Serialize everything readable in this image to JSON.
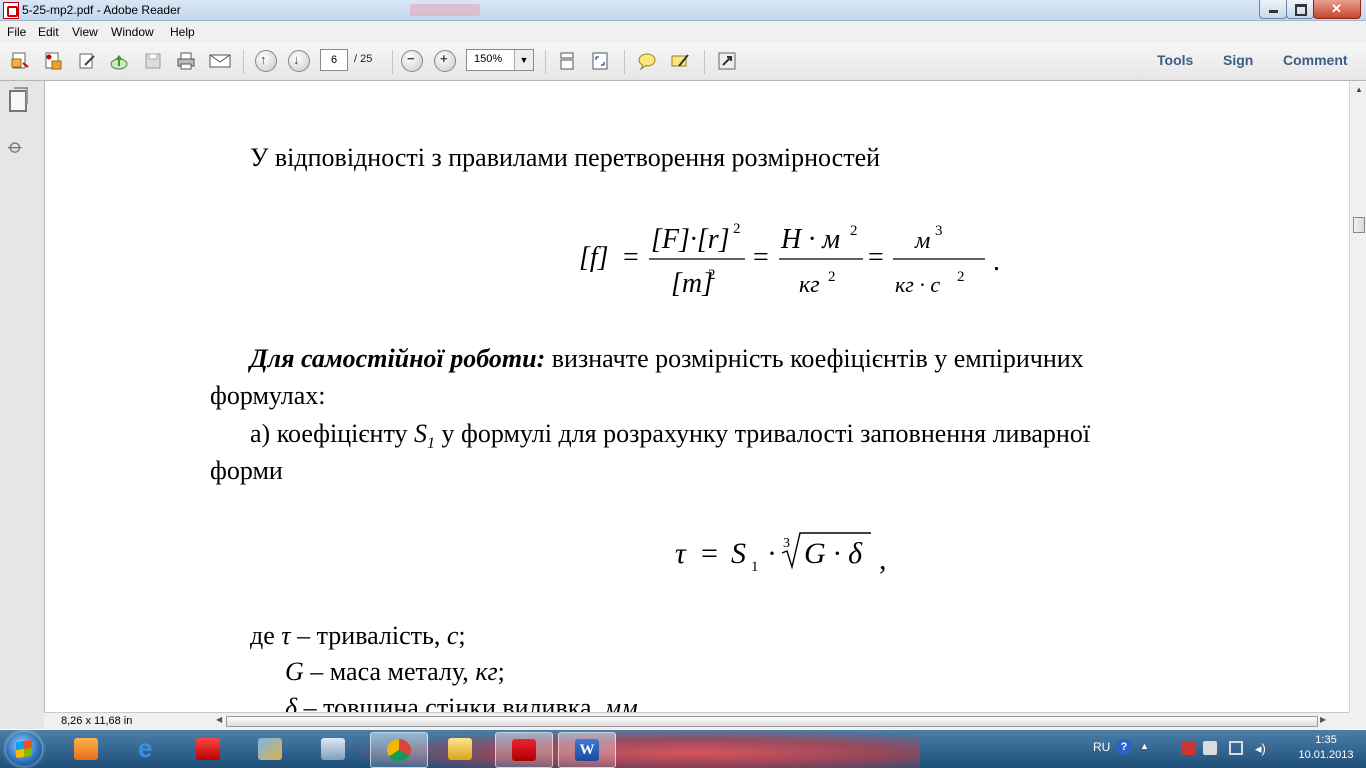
{
  "window": {
    "title": "5-25-mp2.pdf - Adobe Reader"
  },
  "menu": {
    "file": "File",
    "edit": "Edit",
    "view": "View",
    "window": "Window",
    "help": "Help"
  },
  "toolbar": {
    "page_current": "6",
    "page_total": "/ 25",
    "zoom": "150%",
    "zoom_arrow": "▼",
    "tools": "Tools",
    "sign": "Sign",
    "comment": "Comment"
  },
  "document": {
    "line1": "У відповідності з правилами перетворення розмірностей",
    "eq1": {
      "lhs": "[f]",
      "num1": "[F]·[r]",
      "num1_exp": "2",
      "den1": "[m]",
      "den1_exp": "2",
      "num2": "Н · м",
      "num2_exp": "2",
      "den2": "кг",
      "den2_exp": "2",
      "num3": "м",
      "num3_exp": "3",
      "den3": "кг · с",
      "den3_exp": "2",
      "end": "."
    },
    "p2_bold": "Для самостійної роботи:",
    "p2_rest": "визначте розмірність коефіцієнтів у емпіричних",
    "p2_line2": "формулах:",
    "p3_start": "а) коефіцієнту",
    "p3_S": "S",
    "p3_S_sub": "1",
    "p3_rest": "у формулі для розрахунку тривалості заповнення ливарної",
    "p3_line2": "форми",
    "eq2": {
      "tau": "τ",
      "eq": "=",
      "S": "S",
      "S_sub": "1",
      "dot": "·",
      "root_index": "3",
      "radicand": "G · δ",
      "end": ","
    },
    "def1_a": "де",
    "def1_sym": "τ",
    "def1_b": "– тривалість,",
    "def1_unit": "с",
    "def1_end": ";",
    "def2_sym": "G",
    "def2_b": "– маса металу,",
    "def2_unit": "кг",
    "def2_end": ";",
    "def3_sym": "δ",
    "def3_b": "– товщина стінки виливка,",
    "def3_unit": "мм"
  },
  "statusbar": {
    "page_size": "8,26 x 11,68 in"
  },
  "tray": {
    "lang": "RU",
    "time": "1:35",
    "date": "10.01.2013"
  }
}
